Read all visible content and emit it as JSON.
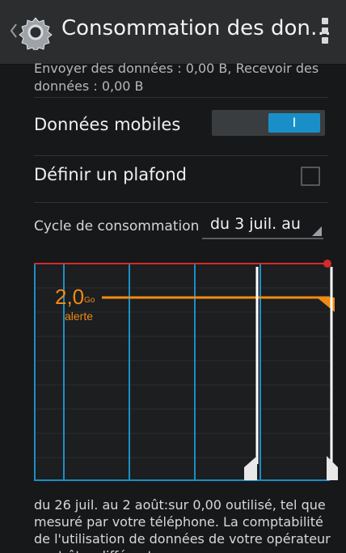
{
  "header": {
    "title": "Consommation des don…",
    "icons": [
      "chevron-left-icon",
      "gear-icon",
      "overflow-menu-icon"
    ]
  },
  "summary": "Envoyer des données : 0,00 B, Recevoir des données : 0,00 B",
  "mobile_data": {
    "label": "Données mobiles",
    "toggle_text": "I",
    "enabled": true
  },
  "limit": {
    "label": "Définir un plafond",
    "checked": false
  },
  "cycle": {
    "label": "Cycle de consommation",
    "value": "du 3 juil. au"
  },
  "chart": {
    "warning_value": "2,0",
    "warning_unit": "Go",
    "warning_label": "alerte",
    "colors": {
      "limit": "#d42a2a",
      "warning": "#f08a12",
      "grid": "#1a8fc7",
      "background": "#1c1e20"
    }
  },
  "footer": "du 26 juil. au 2 août:sur 0,00 outilisé, tel que mesuré par votre téléphone. La comptabilité de l'utilisation de données de votre opérateur peut être différente."
}
